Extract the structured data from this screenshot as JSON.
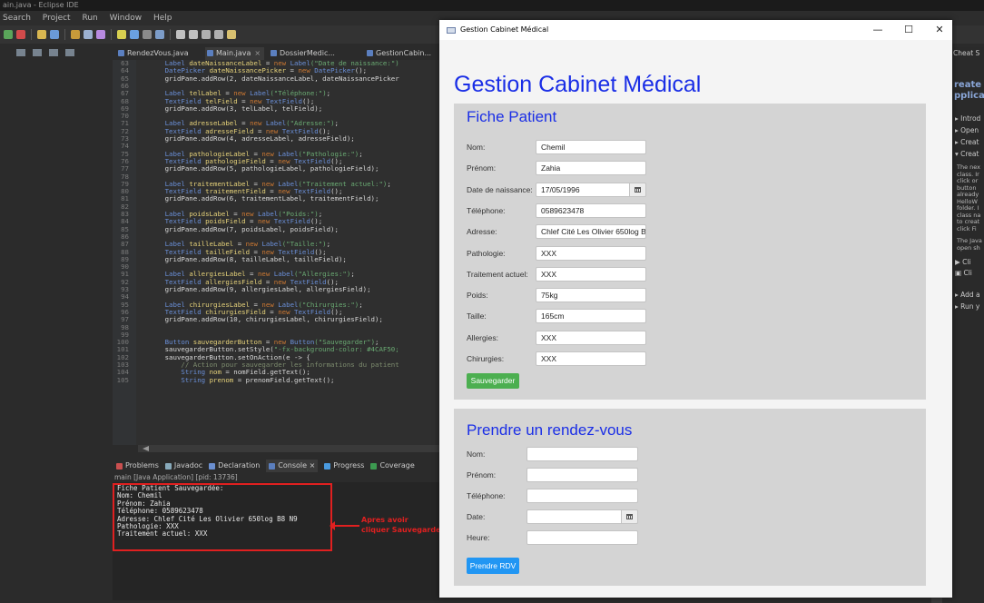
{
  "ide": {
    "window_title": "ain.java - Eclipse IDE",
    "menu": [
      "Search",
      "Project",
      "Run",
      "Window",
      "Help"
    ],
    "editor_tabs": [
      {
        "label": "RendezVous.java",
        "close": ""
      },
      {
        "label": "Main.java",
        "close": "×"
      },
      {
        "label": "DossierMedic...",
        "close": ""
      },
      {
        "label": "GestionCabin...",
        "close": ""
      }
    ],
    "code_lines": [
      {
        "n": "63",
        "parts": [
          [
            "typ",
            "Label "
          ],
          [
            "var",
            "dateNaissanceLabel"
          ],
          [
            "plain",
            " = "
          ],
          [
            "kw",
            "new "
          ],
          [
            "typ",
            "Label"
          ],
          [
            "str",
            "(\"Date de naissance:\")"
          ]
        ]
      },
      {
        "n": "64",
        "parts": [
          [
            "typ",
            "DatePicker "
          ],
          [
            "var",
            "dateNaissancePicker"
          ],
          [
            "plain",
            " = "
          ],
          [
            "kw",
            "new "
          ],
          [
            "typ",
            "DatePicker"
          ],
          [
            "plain",
            "();"
          ]
        ]
      },
      {
        "n": "65",
        "parts": [
          [
            "plain",
            "gridPane.addRow(2, dateNaissanceLabel, dateNaissancePicker"
          ]
        ]
      },
      {
        "n": "66",
        "parts": []
      },
      {
        "n": "67",
        "parts": [
          [
            "typ",
            "Label "
          ],
          [
            "var",
            "telLabel"
          ],
          [
            "plain",
            " = "
          ],
          [
            "kw",
            "new "
          ],
          [
            "typ",
            "Label"
          ],
          [
            "str",
            "(\"Téléphone:\")"
          ],
          [
            "plain",
            ";"
          ]
        ]
      },
      {
        "n": "68",
        "parts": [
          [
            "typ",
            "TextField "
          ],
          [
            "var",
            "telField"
          ],
          [
            "plain",
            " = "
          ],
          [
            "kw",
            "new "
          ],
          [
            "typ",
            "TextField"
          ],
          [
            "plain",
            "();"
          ]
        ]
      },
      {
        "n": "69",
        "parts": [
          [
            "plain",
            "gridPane.addRow(3, telLabel, telField);"
          ]
        ]
      },
      {
        "n": "70",
        "parts": []
      },
      {
        "n": "71",
        "parts": [
          [
            "typ",
            "Label "
          ],
          [
            "var",
            "adresseLabel"
          ],
          [
            "plain",
            " = "
          ],
          [
            "kw",
            "new "
          ],
          [
            "typ",
            "Label"
          ],
          [
            "str",
            "(\"Adresse:\")"
          ],
          [
            "plain",
            ";"
          ]
        ]
      },
      {
        "n": "72",
        "parts": [
          [
            "typ",
            "TextField "
          ],
          [
            "var",
            "adresseField"
          ],
          [
            "plain",
            " = "
          ],
          [
            "kw",
            "new "
          ],
          [
            "typ",
            "TextField"
          ],
          [
            "plain",
            "();"
          ]
        ]
      },
      {
        "n": "73",
        "parts": [
          [
            "plain",
            "gridPane.addRow(4, adresseLabel, adresseField);"
          ]
        ]
      },
      {
        "n": "74",
        "parts": []
      },
      {
        "n": "75",
        "parts": [
          [
            "typ",
            "Label "
          ],
          [
            "var",
            "pathologieLabel"
          ],
          [
            "plain",
            " = "
          ],
          [
            "kw",
            "new "
          ],
          [
            "typ",
            "Label"
          ],
          [
            "str",
            "(\"Pathologie:\")"
          ],
          [
            "plain",
            ";"
          ]
        ]
      },
      {
        "n": "76",
        "parts": [
          [
            "typ",
            "TextField "
          ],
          [
            "var",
            "pathologieField"
          ],
          [
            "plain",
            " = "
          ],
          [
            "kw",
            "new "
          ],
          [
            "typ",
            "TextField"
          ],
          [
            "plain",
            "();"
          ]
        ]
      },
      {
        "n": "77",
        "parts": [
          [
            "plain",
            "gridPane.addRow(5, pathologieLabel, pathologieField);"
          ]
        ]
      },
      {
        "n": "78",
        "parts": []
      },
      {
        "n": "79",
        "parts": [
          [
            "typ",
            "Label "
          ],
          [
            "var",
            "traitementLabel"
          ],
          [
            "plain",
            " = "
          ],
          [
            "kw",
            "new "
          ],
          [
            "typ",
            "Label"
          ],
          [
            "str",
            "(\"Traitement actuel:\")"
          ],
          [
            "plain",
            ";"
          ]
        ]
      },
      {
        "n": "80",
        "parts": [
          [
            "typ",
            "TextField "
          ],
          [
            "var",
            "traitementField"
          ],
          [
            "plain",
            " = "
          ],
          [
            "kw",
            "new "
          ],
          [
            "typ",
            "TextField"
          ],
          [
            "plain",
            "();"
          ]
        ]
      },
      {
        "n": "81",
        "parts": [
          [
            "plain",
            "gridPane.addRow(6, traitementLabel, traitementField);"
          ]
        ]
      },
      {
        "n": "82",
        "parts": []
      },
      {
        "n": "83",
        "parts": [
          [
            "typ",
            "Label "
          ],
          [
            "var",
            "poidsLabel"
          ],
          [
            "plain",
            " = "
          ],
          [
            "kw",
            "new "
          ],
          [
            "typ",
            "Label"
          ],
          [
            "str",
            "(\"Poids:\")"
          ],
          [
            "plain",
            ";"
          ]
        ]
      },
      {
        "n": "84",
        "parts": [
          [
            "typ",
            "TextField "
          ],
          [
            "var",
            "poidsField"
          ],
          [
            "plain",
            " = "
          ],
          [
            "kw",
            "new "
          ],
          [
            "typ",
            "TextField"
          ],
          [
            "plain",
            "();"
          ]
        ]
      },
      {
        "n": "85",
        "parts": [
          [
            "plain",
            "gridPane.addRow(7, poidsLabel, poidsField);"
          ]
        ]
      },
      {
        "n": "86",
        "parts": []
      },
      {
        "n": "87",
        "parts": [
          [
            "typ",
            "Label "
          ],
          [
            "var",
            "tailleLabel"
          ],
          [
            "plain",
            " = "
          ],
          [
            "kw",
            "new "
          ],
          [
            "typ",
            "Label"
          ],
          [
            "str",
            "(\"Taille:\")"
          ],
          [
            "plain",
            ";"
          ]
        ]
      },
      {
        "n": "88",
        "parts": [
          [
            "typ",
            "TextField "
          ],
          [
            "var",
            "tailleField"
          ],
          [
            "plain",
            " = "
          ],
          [
            "kw",
            "new "
          ],
          [
            "typ",
            "TextField"
          ],
          [
            "plain",
            "();"
          ]
        ]
      },
      {
        "n": "89",
        "parts": [
          [
            "plain",
            "gridPane.addRow(8, tailleLabel, tailleField);"
          ]
        ]
      },
      {
        "n": "90",
        "parts": []
      },
      {
        "n": "91",
        "parts": [
          [
            "typ",
            "Label "
          ],
          [
            "var",
            "allergiesLabel"
          ],
          [
            "plain",
            " = "
          ],
          [
            "kw",
            "new "
          ],
          [
            "typ",
            "Label"
          ],
          [
            "str",
            "(\"Allergies:\")"
          ],
          [
            "plain",
            ";"
          ]
        ]
      },
      {
        "n": "92",
        "parts": [
          [
            "typ",
            "TextField "
          ],
          [
            "var",
            "allergiesField"
          ],
          [
            "plain",
            " = "
          ],
          [
            "kw",
            "new "
          ],
          [
            "typ",
            "TextField"
          ],
          [
            "plain",
            "();"
          ]
        ]
      },
      {
        "n": "93",
        "parts": [
          [
            "plain",
            "gridPane.addRow(9, allergiesLabel, allergiesField);"
          ]
        ]
      },
      {
        "n": "94",
        "parts": []
      },
      {
        "n": "95",
        "parts": [
          [
            "typ",
            "Label "
          ],
          [
            "var",
            "chirurgiesLabel"
          ],
          [
            "plain",
            " = "
          ],
          [
            "kw",
            "new "
          ],
          [
            "typ",
            "Label"
          ],
          [
            "str",
            "(\"Chirurgies:\")"
          ],
          [
            "plain",
            ";"
          ]
        ]
      },
      {
        "n": "96",
        "parts": [
          [
            "typ",
            "TextField "
          ],
          [
            "var",
            "chirurgiesField"
          ],
          [
            "plain",
            " = "
          ],
          [
            "kw",
            "new "
          ],
          [
            "typ",
            "TextField"
          ],
          [
            "plain",
            "();"
          ]
        ]
      },
      {
        "n": "97",
        "parts": [
          [
            "plain",
            "gridPane.addRow(10, chirurgiesLabel, chirurgiesField);"
          ]
        ]
      },
      {
        "n": "98",
        "parts": []
      },
      {
        "n": "99",
        "parts": []
      },
      {
        "n": "100",
        "parts": [
          [
            "typ",
            "Button "
          ],
          [
            "var",
            "sauvegarderButton"
          ],
          [
            "plain",
            " = "
          ],
          [
            "kw",
            "new "
          ],
          [
            "typ",
            "Button"
          ],
          [
            "str",
            "(\"Sauvegarder\")"
          ],
          [
            "plain",
            ";"
          ]
        ]
      },
      {
        "n": "101",
        "parts": [
          [
            "plain",
            "sauvegarderButton.setStyle("
          ],
          [
            "str",
            "\"-fx-background-color: #4CAF50;"
          ]
        ]
      },
      {
        "n": "102",
        "parts": [
          [
            "plain",
            "sauvegarderButton.setOnAction(e -> {"
          ]
        ]
      },
      {
        "n": "103",
        "parts": [
          [
            "cmt",
            "    // Action pour sauvegarder les informations du patient"
          ]
        ]
      },
      {
        "n": "104",
        "parts": [
          [
            "typ",
            "    String "
          ],
          [
            "var",
            "nom"
          ],
          [
            "plain",
            " = nomField.getText();"
          ]
        ]
      },
      {
        "n": "105",
        "parts": [
          [
            "typ",
            "    String "
          ],
          [
            "var",
            "prenom"
          ],
          [
            "plain",
            " = prenomField.getText();"
          ]
        ]
      }
    ],
    "bottom_tabs": [
      {
        "label": "Problems",
        "color": "#c94f4f"
      },
      {
        "label": "Javadoc",
        "color": "#8ab"
      },
      {
        "label": "Declaration",
        "color": "#6b8fd0"
      },
      {
        "label": "Console ×",
        "color": "#5b7fbf"
      },
      {
        "label": "Progress",
        "color": "#4a9adf"
      },
      {
        "label": "Coverage",
        "color": "#3c9a50"
      }
    ],
    "console_header": "main [Java Application]  [pid: 13736]",
    "console_lines": [
      "Fiche Patient Sauvegardée:",
      "Nom: Chemil",
      "Prénom: Zahia",
      "Téléphone: 0589623478",
      "Adresse: Chlef Cité Les Olivier 650log B8 N9",
      "Pathologie: XXX",
      "Traitement actuel: XXX"
    ],
    "annotation": {
      "line1": "Apres avoir",
      "line2": "cliquer Sauvegarder",
      "color": "#e02020"
    },
    "right_panel": {
      "tab": "Cheat S",
      "title1": "reate a",
      "title2": "pplica",
      "items": [
        "▸ Introd",
        "▸ Open",
        "▸ Creat",
        "▾ Creat"
      ],
      "para": [
        "The nex",
        "class. Ir",
        "click or",
        "button",
        "already",
        "HelloW",
        "folder. I",
        "class na",
        "to creat",
        "click Fi"
      ],
      "para2": [
        "The Java",
        "open sh"
      ],
      "sub": [
        "▶ Cli",
        "▣ Cli"
      ],
      "items2": [
        "▸ Add a",
        "▸ Run y"
      ]
    }
  },
  "app": {
    "window_title": "Gestion Cabinet Médical",
    "controls": {
      "minimize": "—",
      "maximize": "☐",
      "close": "✕"
    },
    "heading": "Gestion Cabinet Médical",
    "accent": "#1a2ee6",
    "fiche": {
      "title": "Fiche Patient",
      "fields": [
        {
          "label": "Nom:",
          "value": "Chemil"
        },
        {
          "label": "Prénom:",
          "value": "Zahia"
        },
        {
          "label": "Date de naissance:",
          "value": "17/05/1996"
        },
        {
          "label": "Téléphone:",
          "value": "0589623478"
        },
        {
          "label": "Adresse:",
          "value": "Chlef Cité Les Olivier 650log B8"
        },
        {
          "label": "Pathologie:",
          "value": "XXX"
        },
        {
          "label": "Traitement actuel:",
          "value": "XXX"
        },
        {
          "label": "Poids:",
          "value": "75kg"
        },
        {
          "label": "Taille:",
          "value": "165cm"
        },
        {
          "label": "Allergies:",
          "value": "XXX"
        },
        {
          "label": "Chirurgies:",
          "value": "XXX"
        }
      ],
      "save_label": "Sauvegarder",
      "save_color": "#4caf50"
    },
    "rdv": {
      "title": "Prendre un rendez-vous",
      "fields": [
        {
          "label": "Nom:",
          "value": ""
        },
        {
          "label": "Prénom:",
          "value": ""
        },
        {
          "label": "Téléphone:",
          "value": ""
        },
        {
          "label": "Date:",
          "value": ""
        },
        {
          "label": "Heure:",
          "value": ""
        }
      ],
      "submit_label": "Prendre RDV",
      "submit_color": "#2196f3"
    }
  }
}
